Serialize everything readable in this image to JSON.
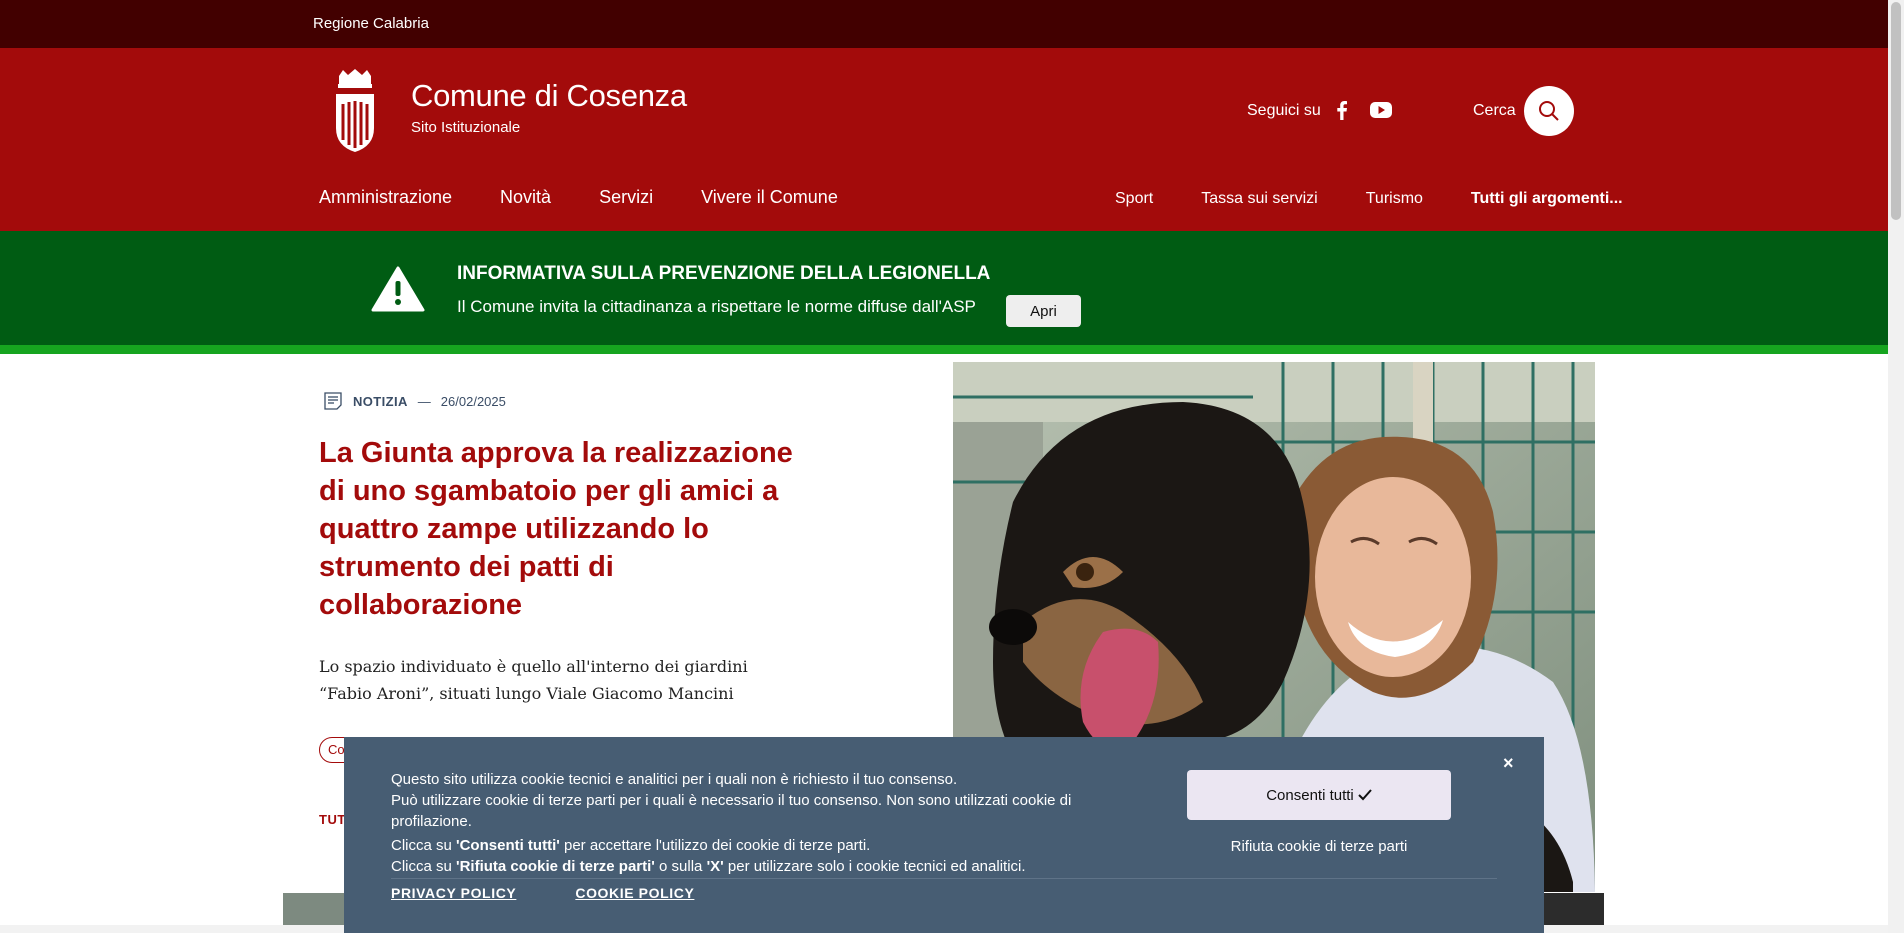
{
  "topbar": {
    "region": "Regione Calabria"
  },
  "header": {
    "title": "Comune di Cosenza",
    "subtitle": "Sito Istituzionale",
    "follow_label": "Seguici su",
    "search_label": "Cerca",
    "main_nav": [
      "Amministrazione",
      "Novità",
      "Servizi",
      "Vivere il Comune"
    ],
    "topics": [
      "Sport",
      "Tassa sui servizi",
      "Turismo",
      "Tutti gli argomenti..."
    ]
  },
  "alert": {
    "title": "INFORMATIVA SULLA PREVENZIONE DELLA LEGIONELLA",
    "text": "Il Comune invita la cittadinanza a rispettare le norme diffuse dall'ASP",
    "button": "Apri"
  },
  "news": {
    "type": "NOTIZIA",
    "separator": "—",
    "date": "26/02/2025",
    "title": "La Giunta approva la realizzazione di uno sgambatoio per gli amici a quattro zampe utilizzando lo strumento dei patti di collaborazione",
    "description": "Lo spazio individuato è quello all'interno dei giardini “Fabio Aroni”, situati lungo Viale Giacomo Mancini",
    "chip": "Co",
    "all_link": "TUT"
  },
  "cookie": {
    "line1": "Questo sito utilizza cookie tecnici e analitici per i quali non è richiesto il tuo consenso.",
    "line2": "Può utilizzare cookie di terze parti per i quali è necessario il tuo consenso. Non sono utilizzati cookie di profilazione.",
    "line3_pre": "Clicca su ",
    "line3_bold": "'Consenti tutti'",
    "line3_post": " per accettare l'utilizzo dei cookie di terze parti.",
    "line4_pre": "Clicca su ",
    "line4_bold1": "'Rifiuta cookie di terze parti'",
    "line4_mid": " o sulla ",
    "line4_bold2": "'X'",
    "line4_post": " per utilizzare solo i cookie tecnici ed analitici.",
    "accept": "Consenti tutti",
    "reject": "Rifiuta cookie di terze parti",
    "close": "×",
    "links": [
      "PRIVACY POLICY",
      "COOKIE POLICY"
    ]
  },
  "colors": {
    "topbar": "#420000",
    "header": "#a30b0b",
    "alert": "#005c13",
    "alert_border": "#16a41f",
    "cookie_bg": "#475d73"
  },
  "icons": [
    "crest-logo",
    "facebook-icon",
    "youtube-icon",
    "search-icon",
    "warning-icon",
    "news-icon",
    "check-icon"
  ]
}
